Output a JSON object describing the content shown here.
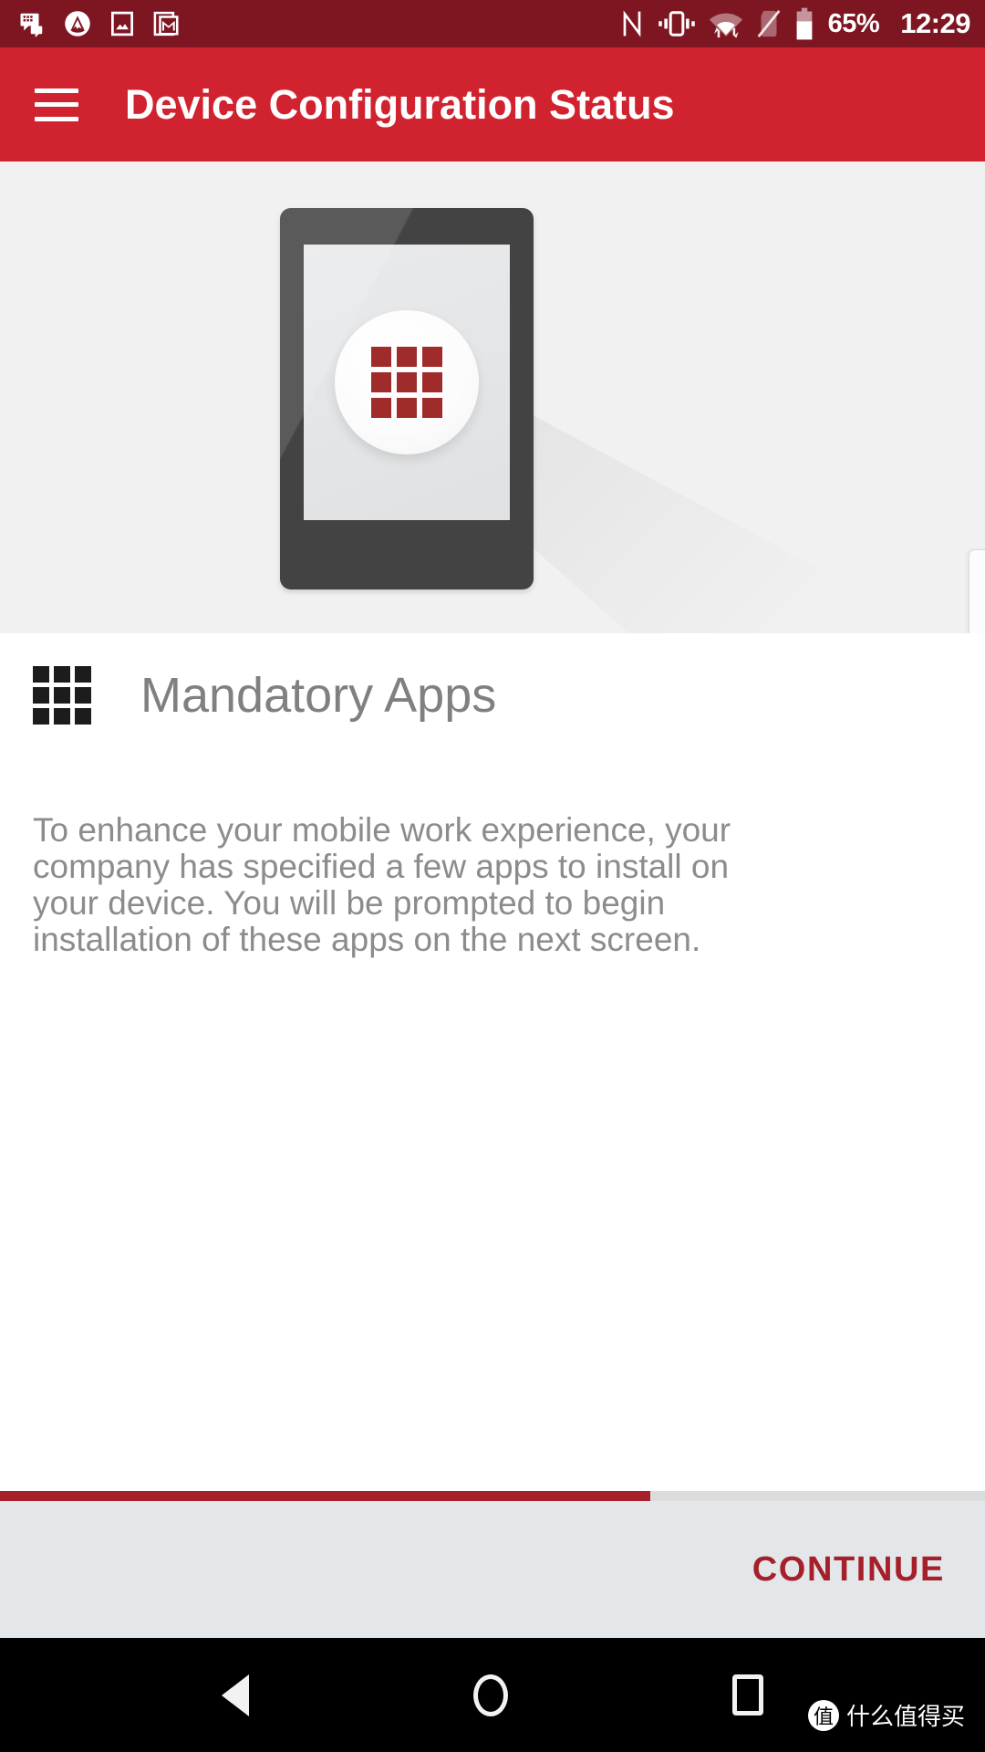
{
  "status_bar": {
    "background_color": "#7E1622",
    "left_icons": [
      {
        "name": "bbm-message-icon",
        "glyph": "bbm"
      },
      {
        "name": "mountain-peak-icon",
        "glyph": "peak"
      },
      {
        "name": "photos-image-icon",
        "glyph": "photo"
      },
      {
        "name": "gmail-mail-icon",
        "glyph": "mail"
      }
    ],
    "right_icons": [
      {
        "name": "nfc-icon",
        "glyph": "N"
      },
      {
        "name": "vibrate-mode-icon",
        "glyph": "vibrate"
      },
      {
        "name": "wifi-no-internet-icon",
        "glyph": "wifi-alert"
      },
      {
        "name": "no-sim-card-icon",
        "glyph": "sim-off"
      },
      {
        "name": "battery-icon",
        "glyph": "battery"
      }
    ],
    "battery_percent": "65%",
    "time": "12:29"
  },
  "app_bar": {
    "background_color": "#D1232F",
    "menu_icon": "hamburger-menu-icon",
    "title": "Device Configuration Status"
  },
  "hero": {
    "background_color": "#F1F1F1",
    "illustration": "tablet-with-app-grid-illustration",
    "device_color": "#434343",
    "screen_color": "#E4E6E8",
    "app_icon_color": "#A02B2B",
    "edge_handle_icon": "drawer-handle-arrow-icon"
  },
  "section": {
    "icon": "apps-grid-icon",
    "icon_color": "#1C1C1C",
    "title": "Mandatory Apps",
    "title_color": "#808080",
    "body": "To enhance your mobile work experience, your company has specified a few apps to install on your device. You will be prompted to begin installation of these apps on the next screen.",
    "body_color": "#8C8C8C"
  },
  "progress": {
    "percent": 66,
    "fill_color": "#A5202A",
    "track_color": "#DCDCDC"
  },
  "footer": {
    "background_color": "#E3E7EA",
    "continue_label": "CONTINUE",
    "continue_color": "#A5202A"
  },
  "nav_bar": {
    "background_color": "#000000",
    "buttons": [
      {
        "name": "nav-back-button",
        "glyph": "triangle-left"
      },
      {
        "name": "nav-home-button",
        "glyph": "circle"
      },
      {
        "name": "nav-recents-button",
        "glyph": "square"
      }
    ]
  },
  "watermark": {
    "badge": "值",
    "text": "什么值得买"
  }
}
